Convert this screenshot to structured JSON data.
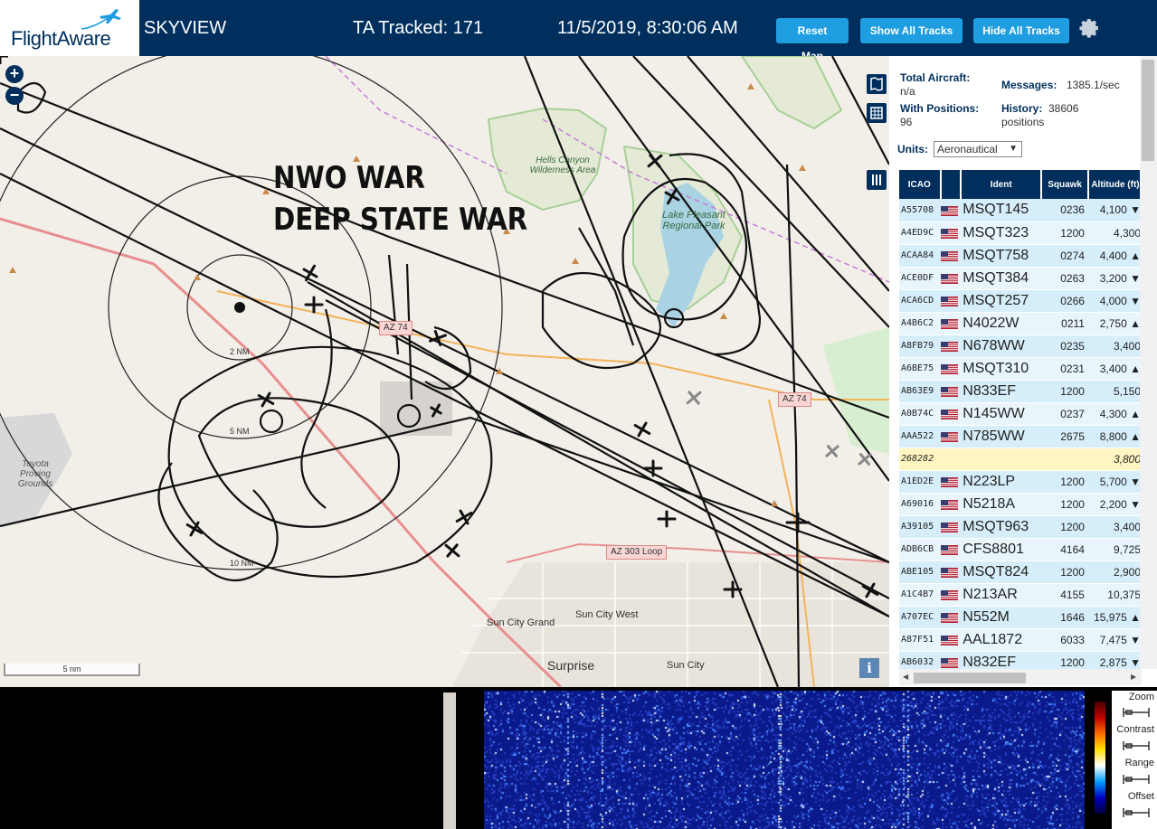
{
  "header": {
    "logo": "FlightAware",
    "site_name": "SKYVIEW",
    "tracked": "TA Tracked: 171",
    "clock": "11/5/2019, 8:30:06 AM",
    "reset_map": "Reset Map",
    "show_all": "Show All Tracks",
    "hide_all": "Hide All Tracks",
    "settings_icon": "gear-icon"
  },
  "map": {
    "overlay_line1": "NWO WAR",
    "overlay_line2": "DEEP STATE WAR",
    "zoom_in": "+",
    "zoom_out": "−",
    "scale": "5 nm",
    "info": "i",
    "range_rings": [
      "2 NM",
      "5 NM",
      "10 NM"
    ],
    "places": {
      "hells_canyon": "Hells Canyon Wilderness Area",
      "lake_pleasant": "Lake Pleasant Regional Park",
      "toyota": "Toyota Proving Grounds",
      "sun_city_grand": "Sun City Grand",
      "sun_city_west": "Sun City West",
      "surprise": "Surprise",
      "sun_city": "Sun City"
    },
    "roads": [
      "AZ 74",
      "AZ 74",
      "AZ 303 Loop"
    ]
  },
  "stats": {
    "total_label": "Total Aircraft:",
    "total_value": "n/a",
    "positions_label": "With Positions:",
    "positions_value": "96",
    "messages_label": "Messages:",
    "messages_value": "1385.1/sec",
    "history_label": "History:",
    "history_value": "38606 positions",
    "units_label": "Units:",
    "units_value": "Aeronautical"
  },
  "table": {
    "headers": [
      "ICAO",
      "",
      "Ident",
      "Squawk",
      "Altitude (ft)"
    ],
    "rows": [
      {
        "icao": "A55708",
        "ident": "MSQT145",
        "squawk": "0236",
        "alt": "4,100 ▼",
        "flag": true
      },
      {
        "icao": "A4ED9C",
        "ident": "MSQT323",
        "squawk": "1200",
        "alt": "4,300",
        "flag": true
      },
      {
        "icao": "ACAA84",
        "ident": "MSQT758",
        "squawk": "0274",
        "alt": "4,400 ▲",
        "flag": true
      },
      {
        "icao": "ACE0DF",
        "ident": "MSQT384",
        "squawk": "0263",
        "alt": "3,200 ▼",
        "flag": true
      },
      {
        "icao": "ACA6CD",
        "ident": "MSQT257",
        "squawk": "0266",
        "alt": "4,000 ▼",
        "flag": true
      },
      {
        "icao": "A4B6C2",
        "ident": "N4022W",
        "squawk": "0211",
        "alt": "2,750 ▲",
        "flag": true
      },
      {
        "icao": "A8FB79",
        "ident": "N678WW",
        "squawk": "0235",
        "alt": "3,400",
        "flag": true
      },
      {
        "icao": "A6BE75",
        "ident": "MSQT310",
        "squawk": "0231",
        "alt": "3,400 ▲",
        "flag": true
      },
      {
        "icao": "AB63E9",
        "ident": "N833EF",
        "squawk": "1200",
        "alt": "5,150",
        "flag": true
      },
      {
        "icao": "A0B74C",
        "ident": "N145WW",
        "squawk": "0237",
        "alt": "4,300 ▲",
        "flag": true
      },
      {
        "icao": "AAA522",
        "ident": "N785WW",
        "squawk": "2675",
        "alt": "8,800 ▲",
        "flag": true
      },
      {
        "icao": "268282",
        "ident": "",
        "squawk": "",
        "alt": "3,800",
        "flag": false
      },
      {
        "icao": "A1ED2E",
        "ident": "N223LP",
        "squawk": "1200",
        "alt": "5,700 ▼",
        "flag": true
      },
      {
        "icao": "A69016",
        "ident": "N5218A",
        "squawk": "1200",
        "alt": "2,200 ▼",
        "flag": true
      },
      {
        "icao": "A39105",
        "ident": "MSQT963",
        "squawk": "1200",
        "alt": "3,400",
        "flag": true
      },
      {
        "icao": "ADB6CB",
        "ident": "CFS8801",
        "squawk": "4164",
        "alt": "9,725",
        "flag": true
      },
      {
        "icao": "ABE105",
        "ident": "MSQT824",
        "squawk": "1200",
        "alt": "2,900",
        "flag": true
      },
      {
        "icao": "A1C4B7",
        "ident": "N213AR",
        "squawk": "4155",
        "alt": "10,375",
        "flag": true
      },
      {
        "icao": "A707EC",
        "ident": "N552M",
        "squawk": "1646",
        "alt": "15,975 ▲",
        "flag": true
      },
      {
        "icao": "A87F51",
        "ident": "AAL1872",
        "squawk": "6033",
        "alt": "7,475 ▼",
        "flag": true
      },
      {
        "icao": "AB6032",
        "ident": "N832EF",
        "squawk": "1200",
        "alt": "2,875 ▼",
        "flag": true
      }
    ]
  },
  "spectrum": {
    "zoom": "Zoom",
    "contrast": "Contrast",
    "range": "Range",
    "offset": "Offset"
  },
  "colors": {
    "header_bg": "#002f5d",
    "button": "#1e9de0",
    "row": "#d6eefa",
    "row_highlight": "#fff5c2",
    "waterfall": "#1a2fa8"
  }
}
